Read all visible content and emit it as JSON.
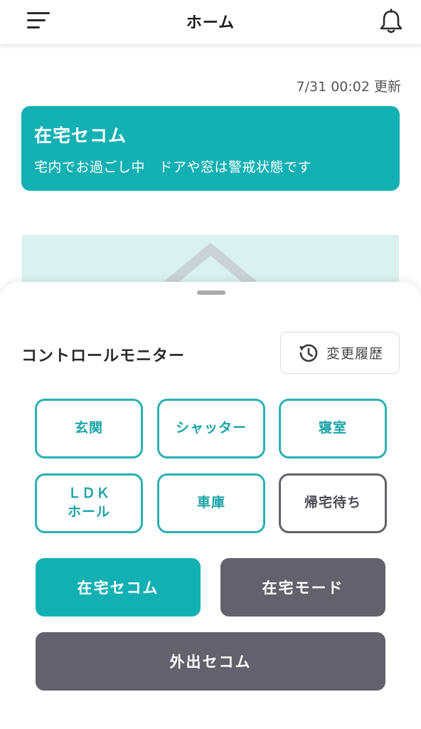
{
  "header": {
    "title": "ホーム",
    "menu_icon": "hamburger-menu-icon",
    "bell_icon": "notification-bell-icon"
  },
  "main": {
    "updated_at": "7/31 00:02 更新",
    "status_card": {
      "title": "在宅セコム",
      "subtitle": "宅内でお過ごし中　ドアや窓は警戒状態です",
      "color": "#13b0b3"
    }
  },
  "sheet": {
    "title": "コントロールモニター",
    "history_button": {
      "label": "変更履歴",
      "icon": "history-clock-icon"
    },
    "zones": [
      {
        "label": "玄関",
        "state": "active"
      },
      {
        "label": "シャッター",
        "state": "active"
      },
      {
        "label": "寝室",
        "state": "active"
      },
      {
        "label": "ＬＤＫ\nホール",
        "state": "active"
      },
      {
        "label": "車庫",
        "state": "active"
      },
      {
        "label": "帰宅待ち",
        "state": "inactive"
      }
    ],
    "modes": {
      "home_secom": "在宅セコム",
      "home_mode": "在宅モード",
      "away_secom": "外出セコム"
    }
  },
  "colors": {
    "accent": "#13b0b3",
    "zone_border": "#2bb0b4",
    "neutral_button": "#62616c",
    "floorplan_bg": "#d9f1ef"
  }
}
